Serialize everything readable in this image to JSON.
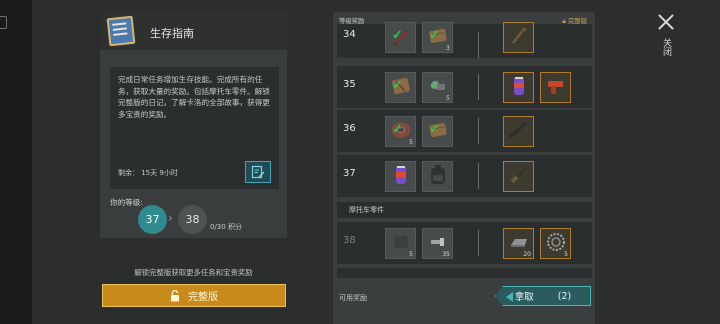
{
  "guide": {
    "title": "生存指南",
    "description": "完成日常任务增加生存技能。完成所有的任务，获取大量的奖励。包括摩托车零件。解锁完整版的日记，了解卡洛的全部故事，获得更多宝贵的奖励。",
    "remaining": "剩余：  15天 9小时",
    "level_label": "你的等级:",
    "current_level": "37",
    "next_level": "38",
    "points": "0/30 积分"
  },
  "unlock": {
    "tip": "解锁完整版获取更多任务和宝贵奖励",
    "button_label": "完整版"
  },
  "rewards": {
    "header": "等级奖励",
    "premium_label": "完整版",
    "section_label": "摩托车零件",
    "footer_label": "可用奖励",
    "claim_label": "拿取",
    "claim_count": "(2)",
    "rows": [
      {
        "level": "34",
        "free": [
          {
            "icon": "knife-icon",
            "qty": "",
            "claimed": true
          },
          {
            "icon": "wood-plank-icon",
            "qty": "3",
            "claimed": true
          }
        ],
        "premium": [
          {
            "icon": "crowbar-icon",
            "qty": ""
          }
        ]
      },
      {
        "level": "35",
        "free": [
          {
            "icon": "cloth-bundle-icon",
            "qty": "",
            "claimed": true
          },
          {
            "icon": "scrap-metal-icon",
            "qty": "5",
            "claimed": true
          }
        ],
        "premium": [
          {
            "icon": "soda-can-icon",
            "qty": ""
          },
          {
            "icon": "flare-gun-icon",
            "qty": ""
          }
        ]
      },
      {
        "level": "36",
        "free": [
          {
            "icon": "rope-coil-icon",
            "qty": "5",
            "claimed": true
          },
          {
            "icon": "wood-plank-icon",
            "qty": "",
            "claimed": true
          }
        ],
        "premium": [
          {
            "icon": "rifle-icon",
            "qty": ""
          }
        ]
      },
      {
        "level": "37",
        "free": [
          {
            "icon": "soda-can-icon",
            "qty": "",
            "claimed": false
          },
          {
            "icon": "backpack-icon",
            "qty": "",
            "claimed": false
          }
        ],
        "premium": [
          {
            "icon": "shotgun-icon",
            "qty": ""
          }
        ]
      },
      {
        "level": "38",
        "free": [
          {
            "icon": "metal-plate-icon",
            "qty": "5",
            "claimed": false
          },
          {
            "icon": "bolts-icon",
            "qty": "35",
            "claimed": false
          }
        ],
        "premium": [
          {
            "icon": "steel-ingot-icon",
            "qty": "20"
          },
          {
            "icon": "gear-ring-icon",
            "qty": "5"
          }
        ]
      }
    ]
  },
  "close_label": "关闭",
  "colors": {
    "accent": "#2f8b8e",
    "premium": "#c88a1a",
    "check": "#3fcf57"
  }
}
